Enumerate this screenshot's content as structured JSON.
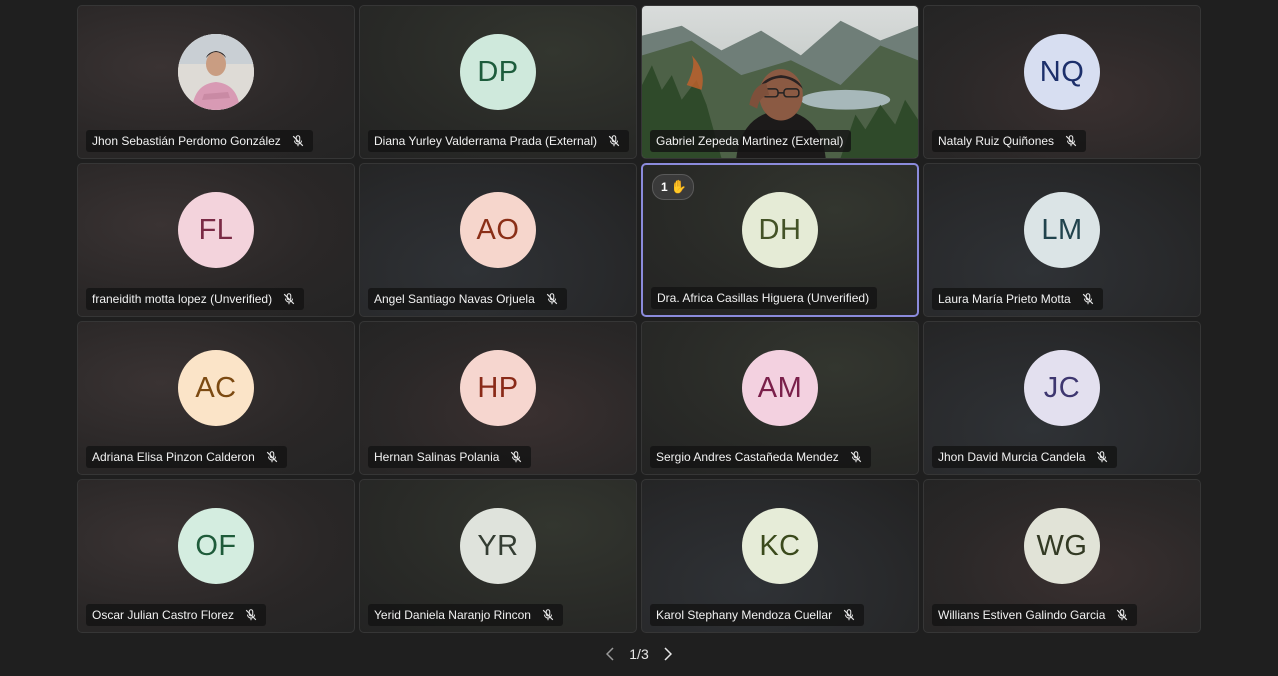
{
  "participants": [
    {
      "name": "Jhon Sebastián Perdomo González",
      "initials": "",
      "type": "photo",
      "bg": "#e8e6e4",
      "fg": "#000000",
      "tile": "t0",
      "muted": true
    },
    {
      "name": "Diana Yurley Valderrama Prada (External)",
      "initials": "DP",
      "type": "avatar",
      "bg": "#cfe9dc",
      "fg": "#1d5c3c",
      "tile": "t1",
      "muted": true
    },
    {
      "name": "Gabriel Zepeda Martinez (External)",
      "initials": "",
      "type": "video",
      "bg": "#5b7a55",
      "fg": "#ffffff",
      "tile": "t2",
      "muted": false
    },
    {
      "name": "Nataly Ruiz Quiñones",
      "initials": "NQ",
      "type": "avatar",
      "bg": "#d7def1",
      "fg": "#1c2f6b",
      "tile": "t3",
      "muted": true
    },
    {
      "name": "franeidith motta lopez (Unverified)",
      "initials": "FL",
      "type": "avatar",
      "bg": "#f3d3dc",
      "fg": "#7a2a45",
      "tile": "t0",
      "muted": true
    },
    {
      "name": "Angel Santiago Navas Orjuela",
      "initials": "AO",
      "type": "avatar",
      "bg": "#f6d6cc",
      "fg": "#8a2f17",
      "tile": "t2",
      "muted": true
    },
    {
      "name": "Dra. Africa Casillas Higuera (Unverified)",
      "initials": "DH",
      "type": "avatar",
      "bg": "#e5ebd6",
      "fg": "#435226",
      "tile": "t1",
      "muted": false,
      "active": true,
      "hand": "1"
    },
    {
      "name": "Laura María Prieto Motta",
      "initials": "LM",
      "type": "avatar",
      "bg": "#dbe4e6",
      "fg": "#21434d",
      "tile": "t2",
      "muted": true
    },
    {
      "name": "Adriana Elisa Pinzon Calderon",
      "initials": "AC",
      "type": "avatar",
      "bg": "#fbe4c8",
      "fg": "#7c4a12",
      "tile": "t0",
      "muted": true
    },
    {
      "name": "Hernan Salinas Polania",
      "initials": "HP",
      "type": "avatar",
      "bg": "#f6d6cf",
      "fg": "#8a2a18",
      "tile": "t3",
      "muted": true
    },
    {
      "name": "Sergio Andres Castañeda Mendez",
      "initials": "AM",
      "type": "avatar",
      "bg": "#f3d1e0",
      "fg": "#7a1f4a",
      "tile": "t1",
      "muted": true
    },
    {
      "name": "Jhon David Murcia Candela",
      "initials": "JC",
      "type": "avatar",
      "bg": "#e3e0ef",
      "fg": "#3e3770",
      "tile": "t2",
      "muted": true
    },
    {
      "name": "Oscar Julian Castro Florez",
      "initials": "OF",
      "type": "avatar",
      "bg": "#d4ede0",
      "fg": "#1e5b3a",
      "tile": "t0",
      "muted": true
    },
    {
      "name": "Yerid Daniela Naranjo Rincon",
      "initials": "YR",
      "type": "avatar",
      "bg": "#dfe3dc",
      "fg": "#343d33",
      "tile": "t1",
      "muted": true
    },
    {
      "name": "Karol Stephany Mendoza Cuellar",
      "initials": "KC",
      "type": "avatar",
      "bg": "#e6ecd8",
      "fg": "#3b4a1c",
      "tile": "t2",
      "muted": true
    },
    {
      "name": "Willians Estiven Galindo Garcia",
      "initials": "WG",
      "type": "avatar",
      "bg": "#e1e3d7",
      "fg": "#333a24",
      "tile": "t3",
      "muted": true
    }
  ],
  "pagination": {
    "label": "1/3",
    "prev_icon": "chevron-left-icon",
    "next_icon": "chevron-right-icon"
  },
  "icons": {
    "muted": "mic-off-icon",
    "raised_hand": "raised-hand-icon"
  }
}
